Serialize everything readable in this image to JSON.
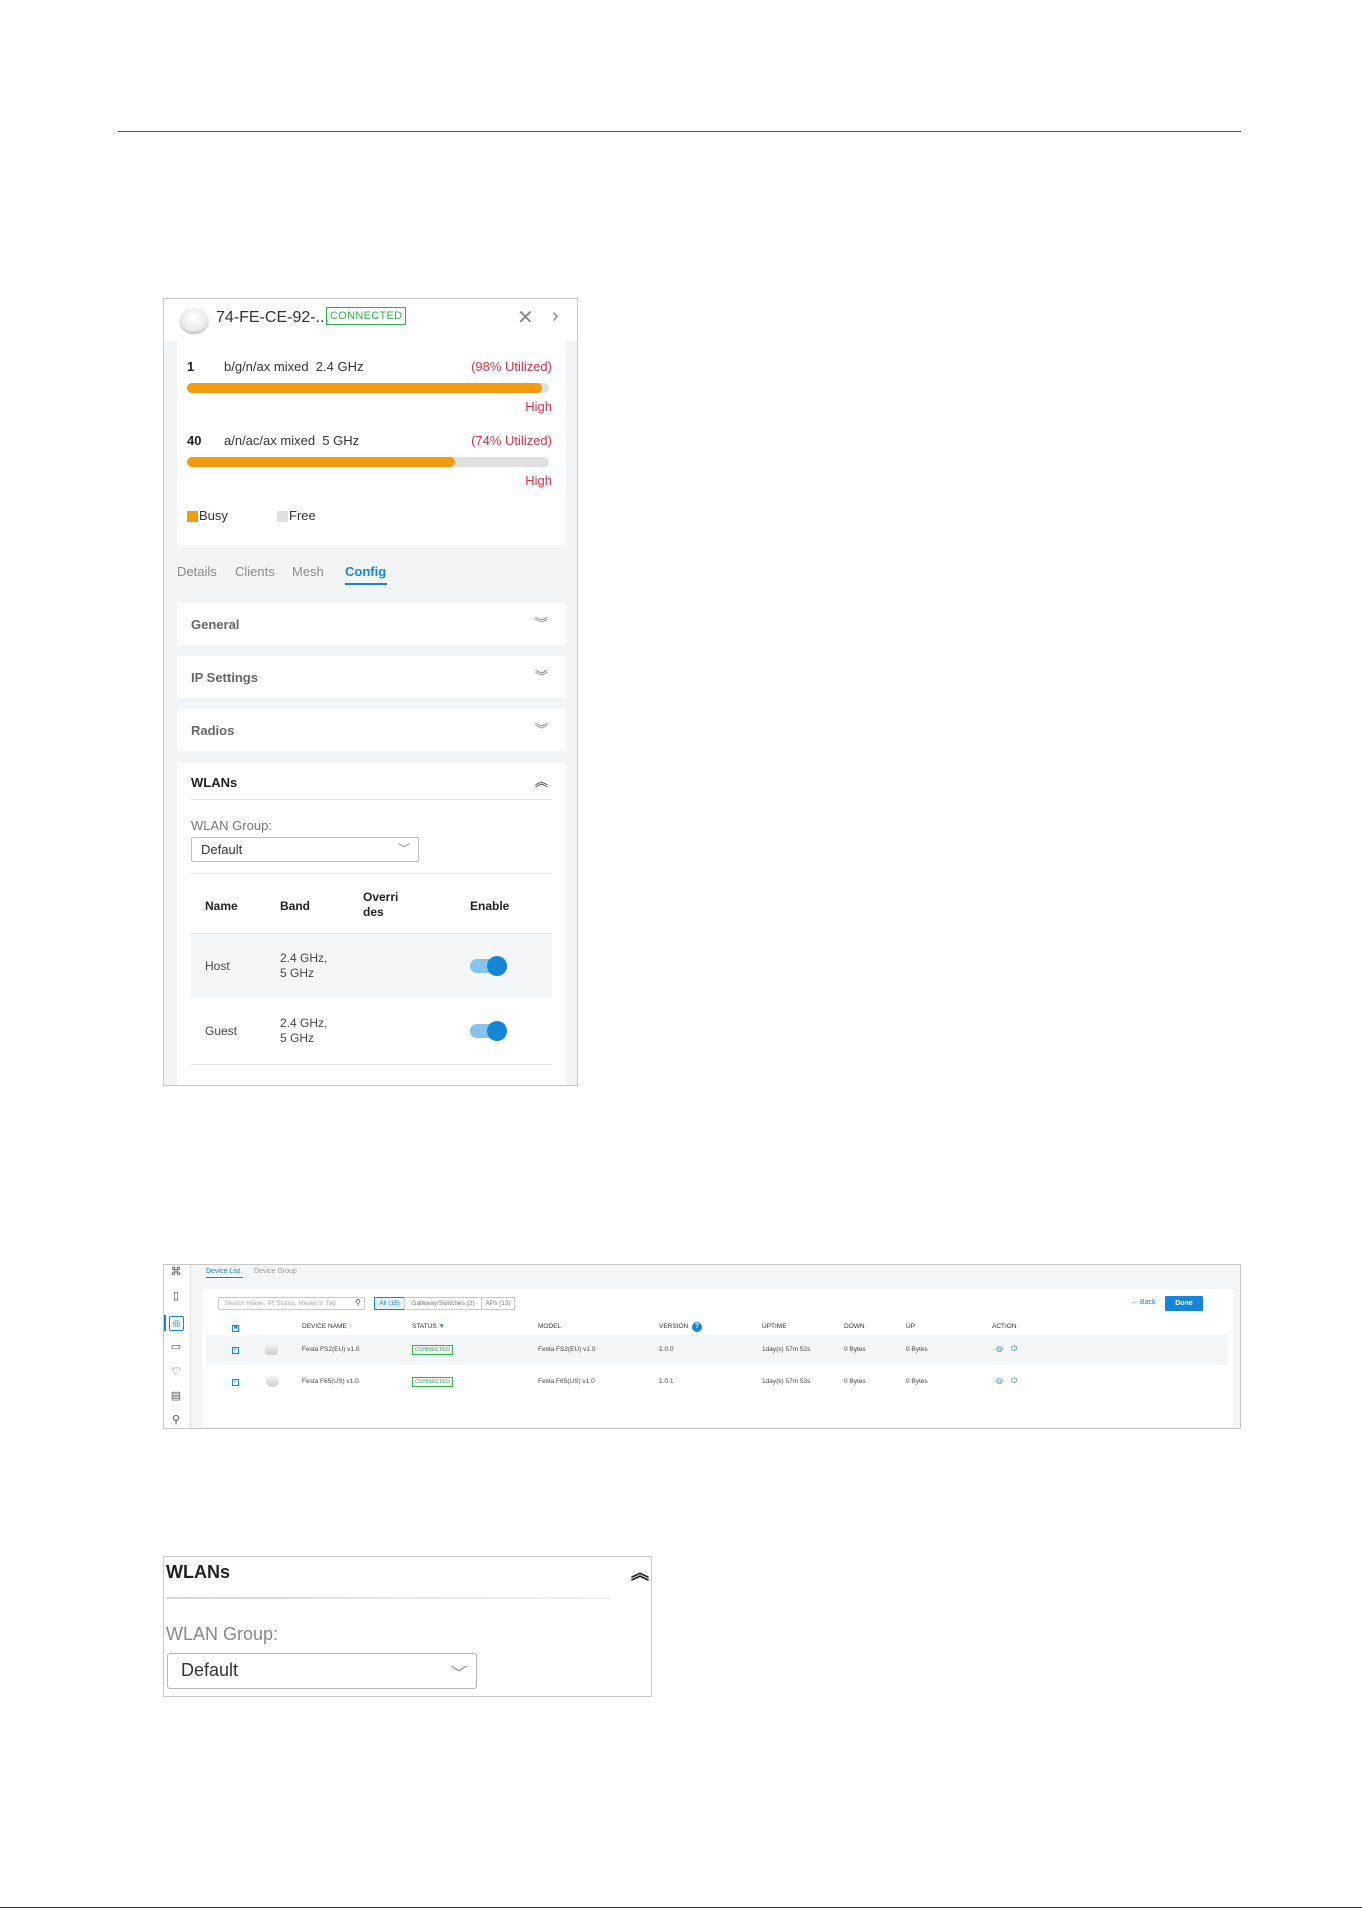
{
  "device_panel": {
    "device_name": "74-FE-CE-92-...",
    "status_badge": "CONNECTED",
    "close_icon": "close-icon",
    "next_icon": "chevron-right-icon",
    "channels": [
      {
        "channel": "1",
        "mode": "b/g/n/ax mixed  2.4 GHz",
        "utilization_text": "(98% Utilized)",
        "utilization": 0.98,
        "level": "High"
      },
      {
        "channel": "40",
        "mode": "a/n/ac/ax mixed  5 GHz",
        "utilization_text": "(74% Utilized)",
        "utilization": 0.74,
        "level": "High"
      }
    ],
    "legend": {
      "busy": "Busy",
      "free": "Free",
      "busy_color": "#f29a10",
      "free_color": "#e0e0e0"
    },
    "tabs": [
      "Details",
      "Clients",
      "Mesh",
      "Config"
    ],
    "active_tab": "Config",
    "sections": [
      "General",
      "IP Settings",
      "Radios"
    ],
    "wlans": {
      "title": "WLANs",
      "group_label": "WLAN Group:",
      "group_value": "Default",
      "columns": [
        "Name",
        "Band",
        "Overri\ndes",
        "Enable"
      ],
      "rows": [
        {
          "name": "Host",
          "band": "2.4 GHz,\n5 GHz",
          "enabled": true
        },
        {
          "name": "Guest",
          "band": "2.4 GHz,\n5 GHz",
          "enabled": true
        }
      ]
    }
  },
  "device_list": {
    "tabs": [
      "Device List",
      "Device Group"
    ],
    "search_placeholder": "Search Name, IP, Status, Model or Tag",
    "filters": [
      "All (15)",
      "Gateway/Switches (2)",
      "APs (13)"
    ],
    "back_label": "Back",
    "done_label": "Done",
    "columns": [
      "DEVICE NAME",
      "STATUS",
      "MODEL",
      "VERSION",
      "UPTIME",
      "DOWN",
      "UP",
      "ACTION"
    ],
    "sort_indicator": "↑",
    "rows": [
      {
        "name": "Festa FS2(EU) v1.0",
        "status": "CONNECTED",
        "model": "Festa FS2(EU) v1.0",
        "version": "1.0.0",
        "uptime": "1day(s) 57m 52s",
        "down": "0 Bytes",
        "up": "0 Bytes"
      },
      {
        "name": "Festa F65(US) v1.0",
        "status": "CONNECTED",
        "model": "Festa F65(US) v1.0",
        "version": "1.0.1",
        "uptime": "1day(s) 57m 53s",
        "down": "0 Bytes",
        "up": "0 Bytes"
      }
    ],
    "accent_color": "#1585d8"
  },
  "wlan_zoom": {
    "title": "WLANs",
    "group_label": "WLAN Group:",
    "group_value": "Default"
  }
}
